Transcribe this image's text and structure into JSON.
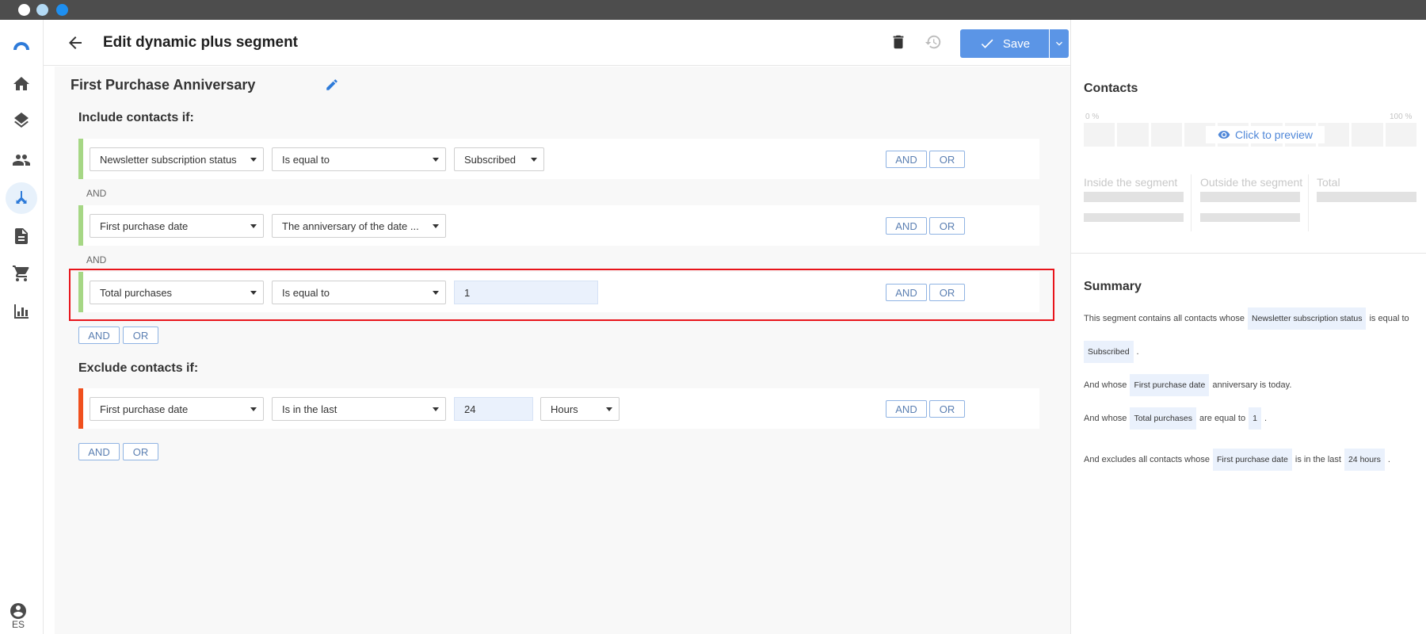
{
  "header": {
    "title": "Edit dynamic plus segment",
    "save_label": "Save"
  },
  "nav": {
    "language": "ES"
  },
  "segment": {
    "name": "First Purchase Anniversary",
    "include_label": "Include contacts if:",
    "exclude_label": "Exclude contacts if:",
    "logic_and": "AND",
    "include_conditions": [
      {
        "field": "Newsletter subscription status",
        "operator": "Is equal to",
        "value": "Subscribed"
      },
      {
        "field": "First purchase date",
        "operator": "The anniversary of the date ..."
      },
      {
        "field": "Total purchases",
        "operator": "Is equal to",
        "value": "1"
      }
    ],
    "exclude_conditions": [
      {
        "field": "First purchase date",
        "operator": "Is in the last",
        "value": "24",
        "unit": "Hours"
      }
    ],
    "and_label": "AND",
    "or_label": "OR"
  },
  "contacts_panel": {
    "title": "Contacts",
    "pct_min": "0 %",
    "pct_max": "100 %",
    "preview_label": "Click to preview",
    "inside_label": "Inside the segment",
    "outside_label": "Outside the segment",
    "total_label": "Total"
  },
  "summary": {
    "title": "Summary",
    "line1_prefix": "This segment contains all contacts whose",
    "line1_chip": "Newsletter subscription status",
    "line1_suffix": "is equal to",
    "line2_chip": "Subscribed",
    "line2_suffix": ".",
    "line3_prefix": "And whose",
    "line3_chip": "First purchase date",
    "line3_suffix": "anniversary is today.",
    "line4_prefix": "And whose",
    "line4_chip": "Total purchases",
    "line4_mid": "are equal to",
    "line4_chip2": "1",
    "line4_suffix": ".",
    "line5_prefix": "And excludes all contacts whose",
    "line5_chip": "First purchase date",
    "line5_mid": "is in the last",
    "line5_chip2": "24 hours",
    "line5_suffix": "."
  },
  "colors": {
    "accent": "#5b95e6",
    "include_bar": "#a6d785",
    "exclude_bar": "#f0501e",
    "highlight": "#e8141b"
  }
}
